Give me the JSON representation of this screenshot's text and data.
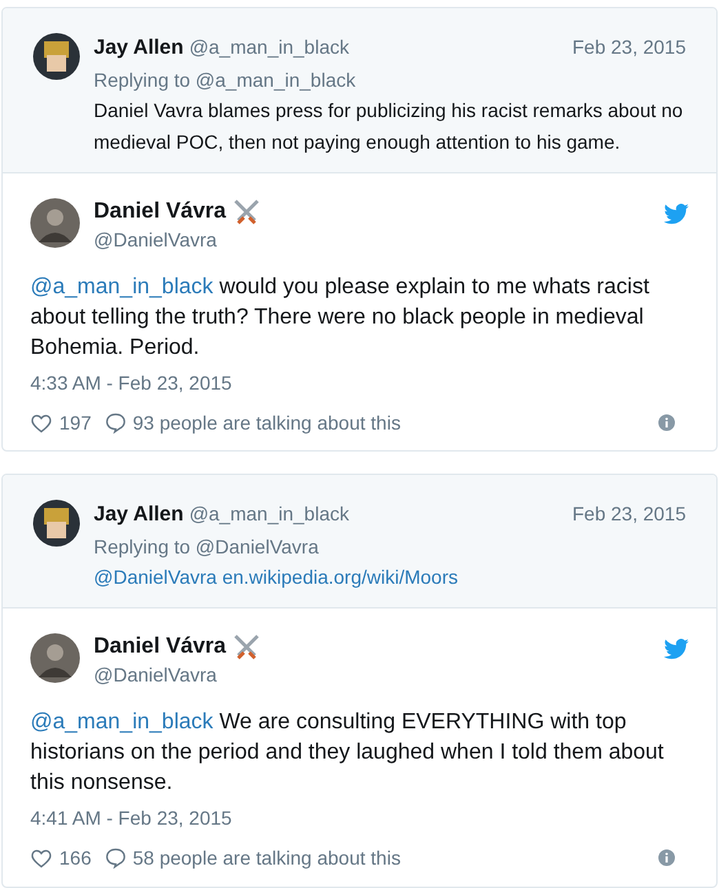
{
  "threads": [
    {
      "quote": {
        "name": "Jay Allen",
        "handle": "@a_man_in_black",
        "date": "Feb 23, 2015",
        "replying": "Replying to @a_man_in_black",
        "body": [
          {
            "kind": "text",
            "text": "Daniel Vavra blames press for publicizing his racist remarks about no medieval POC, then not paying enough attention to his game."
          }
        ]
      },
      "tweet": {
        "name": "Daniel Vávra",
        "handle": "@DanielVavra",
        "body": [
          {
            "kind": "link",
            "text": "@a_man_in_black"
          },
          {
            "kind": "text",
            "text": "would you please explain to me whats racist about telling the truth? There were no black people in medieval Bohemia. Period."
          }
        ],
        "time": "4:33 AM - Feb 23, 2015",
        "likes": "197",
        "talking": "93 people are talking about this"
      }
    },
    {
      "quote": {
        "name": "Jay Allen",
        "handle": "@a_man_in_black",
        "date": "Feb 23, 2015",
        "replying": "Replying to @DanielVavra",
        "body": [
          {
            "kind": "link",
            "text": "@DanielVavra"
          },
          {
            "kind": "link",
            "text": "en.wikipedia.org/wiki/Moors"
          }
        ]
      },
      "tweet": {
        "name": "Daniel Vávra",
        "handle": "@DanielVavra",
        "body": [
          {
            "kind": "link",
            "text": "@a_man_in_black"
          },
          {
            "kind": "text",
            "text": "We are consulting EVERYTHING with top historians on the period and they laughed when I told them about this nonsense."
          }
        ],
        "time": "4:41 AM - Feb 23, 2015",
        "likes": "166",
        "talking": "58 people are talking about this"
      }
    }
  ]
}
